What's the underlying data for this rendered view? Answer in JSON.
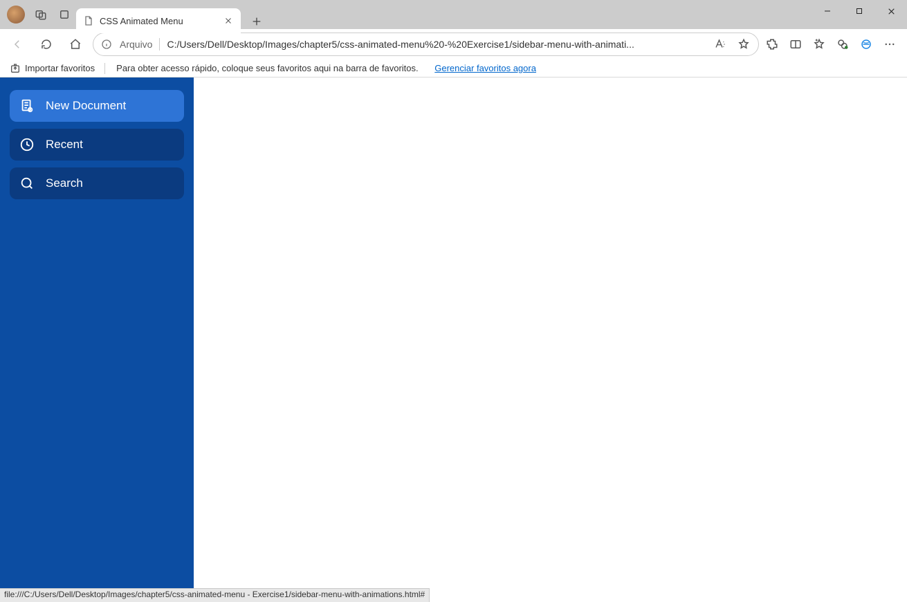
{
  "browser": {
    "tab_title": "CSS Animated Menu",
    "address": {
      "scheme_label": "Arquivo",
      "url": "C:/Users/Dell/Desktop/Images/chapter5/css-animated-menu%20-%20Exercise1/sidebar-menu-with-animati..."
    },
    "favbar": {
      "import_label": "Importar favoritos",
      "hint": "Para obter acesso rápido, coloque seus favoritos aqui na barra de favoritos.",
      "link": "Gerenciar favoritos agora"
    },
    "statusbar": "file:///C:/Users/Dell/Desktop/Images/chapter5/css-animated-menu - Exercise1/sidebar-menu-with-animations.html#"
  },
  "sidebar": {
    "items": [
      {
        "label": "New Document",
        "active": true
      },
      {
        "label": "Recent",
        "active": false
      },
      {
        "label": "Search",
        "active": false
      }
    ]
  }
}
